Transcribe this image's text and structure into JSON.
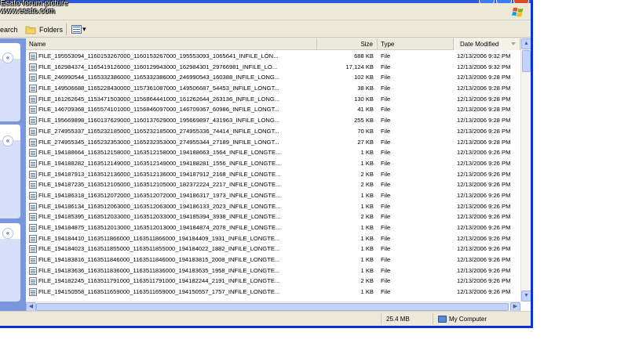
{
  "watermark": [
    "Esato forum picture",
    "www.esato.com"
  ],
  "toolbar": {
    "search_label": "earch",
    "folders_label": "Folders",
    "views_arrow": "▾"
  },
  "taskpane": {
    "chevron": "«"
  },
  "columns": {
    "name": "Name",
    "size": "Size",
    "type": "Type",
    "date": "Date Modified"
  },
  "files": [
    [
      "FILE_195553094_1160153267000_1160153267000_195553093_1065641_INFILE_LON...",
      "688 KB",
      "File",
      "12/13/2006 9:32 PM"
    ],
    [
      "FILE_162984374_1165419126000_1160129943000_162984301_29766981_INFILE_LO...",
      "17,124 KB",
      "File",
      "12/13/2006 9:32 PM"
    ],
    [
      "FILE_246990544_1165332386000_1165332386000_246990543_160388_INFILE_LONG...",
      "102 KB",
      "File",
      "12/13/2006 9:28 PM"
    ],
    [
      "FILE_149506688_1165228430000_1157361087000_149506687_54453_INFILE_LONGT...",
      "38 KB",
      "File",
      "12/13/2006 9:28 PM"
    ],
    [
      "FILE_161262645_1153471503000_1156864441000_161262644_263136_INFILE_LONG...",
      "130 KB",
      "File",
      "12/13/2006 9:28 PM"
    ],
    [
      "FILE_146709368_1165574101000_1156846097000_146709367_60986_INFILE_LONGT...",
      "41 KB",
      "File",
      "12/13/2006 9:28 PM"
    ],
    [
      "FILE_195669898_1160137629000_1160137629000_195669897_431963_INFILE_LONG...",
      "255 KB",
      "File",
      "12/13/2006 9:28 PM"
    ],
    [
      "FILE_274955337_1165232185000_1165232185000_274955336_74414_INFILE_LONGT...",
      "70 KB",
      "File",
      "12/13/2006 9:28 PM"
    ],
    [
      "FILE_274955345_1165232353000_1165232353000_274955344_27189_INFILE_LONGT...",
      "27 KB",
      "File",
      "12/13/2006 9:28 PM"
    ],
    [
      "FILE_194188664_1163512158000_1163512158000_194188663_1564_INFILE_LONGTE...",
      "1 KB",
      "File",
      "12/13/2006 9:26 PM"
    ],
    [
      "FILE_194188282_1163512149000_1163512149000_194188281_1556_INFILE_LONGTE...",
      "1 KB",
      "File",
      "12/13/2006 9:26 PM"
    ],
    [
      "FILE_194187913_1163512136000_1163512136000_194187912_2168_INFILE_LONGTE...",
      "2 KB",
      "File",
      "12/13/2006 9:26 PM"
    ],
    [
      "FILE_194187235_1163512105000_1163512105000_182372224_2217_INFILE_LONGTE...",
      "2 KB",
      "File",
      "12/13/2006 9:26 PM"
    ],
    [
      "FILE_194186318_1163512072000_1163512072000_194186317_1973_INFILE_LONGTE...",
      "1 KB",
      "File",
      "12/13/2006 9:26 PM"
    ],
    [
      "FILE_194186134_1163512063000_1163512063000_194186133_2023_INFILE_LONGTE...",
      "1 KB",
      "File",
      "12/13/2006 9:26 PM"
    ],
    [
      "FILE_194185395_1163512033000_1163512033000_194185394_3938_INFILE_LONGTE...",
      "2 KB",
      "File",
      "12/13/2006 9:26 PM"
    ],
    [
      "FILE_194184875_1163512013000_1163512013000_194184874_2078_INFILE_LONGTE...",
      "1 KB",
      "File",
      "12/13/2006 9:26 PM"
    ],
    [
      "FILE_194184410_1163511866000_1163511866000_194184409_1931_INFILE_LONGTE...",
      "1 KB",
      "File",
      "12/13/2006 9:26 PM"
    ],
    [
      "FILE_194184023_1163511855000_1163511855000_194184022_1882_INFILE_LONGTE...",
      "1 KB",
      "File",
      "12/13/2006 9:26 PM"
    ],
    [
      "FILE_194183816_1163511846000_1163511846000_194183815_2008_INFILE_LONGTE...",
      "1 KB",
      "File",
      "12/13/2006 9:26 PM"
    ],
    [
      "FILE_194183636_1163511836000_1163511836000_194183635_1958_INFILE_LONGTE...",
      "1 KB",
      "File",
      "12/13/2006 9:26 PM"
    ],
    [
      "FILE_194182245_1163511791000_1163511791000_194182244_2191_INFILE_LONGTE...",
      "2 KB",
      "File",
      "12/13/2006 9:26 PM"
    ],
    [
      "FILE_194150558_1163511659000_1163511659000_194150557_1757_INFILE_LONGTE...",
      "1 KB",
      "File",
      "12/13/2006 9:26 PM"
    ]
  ],
  "statusbar": {
    "total_size": "25.4 MB",
    "location": "My Computer"
  },
  "colors": {
    "taskpane": "#7a96df",
    "titlebar": "#2a5ad7",
    "scrollbar": "#c3d3fd"
  }
}
